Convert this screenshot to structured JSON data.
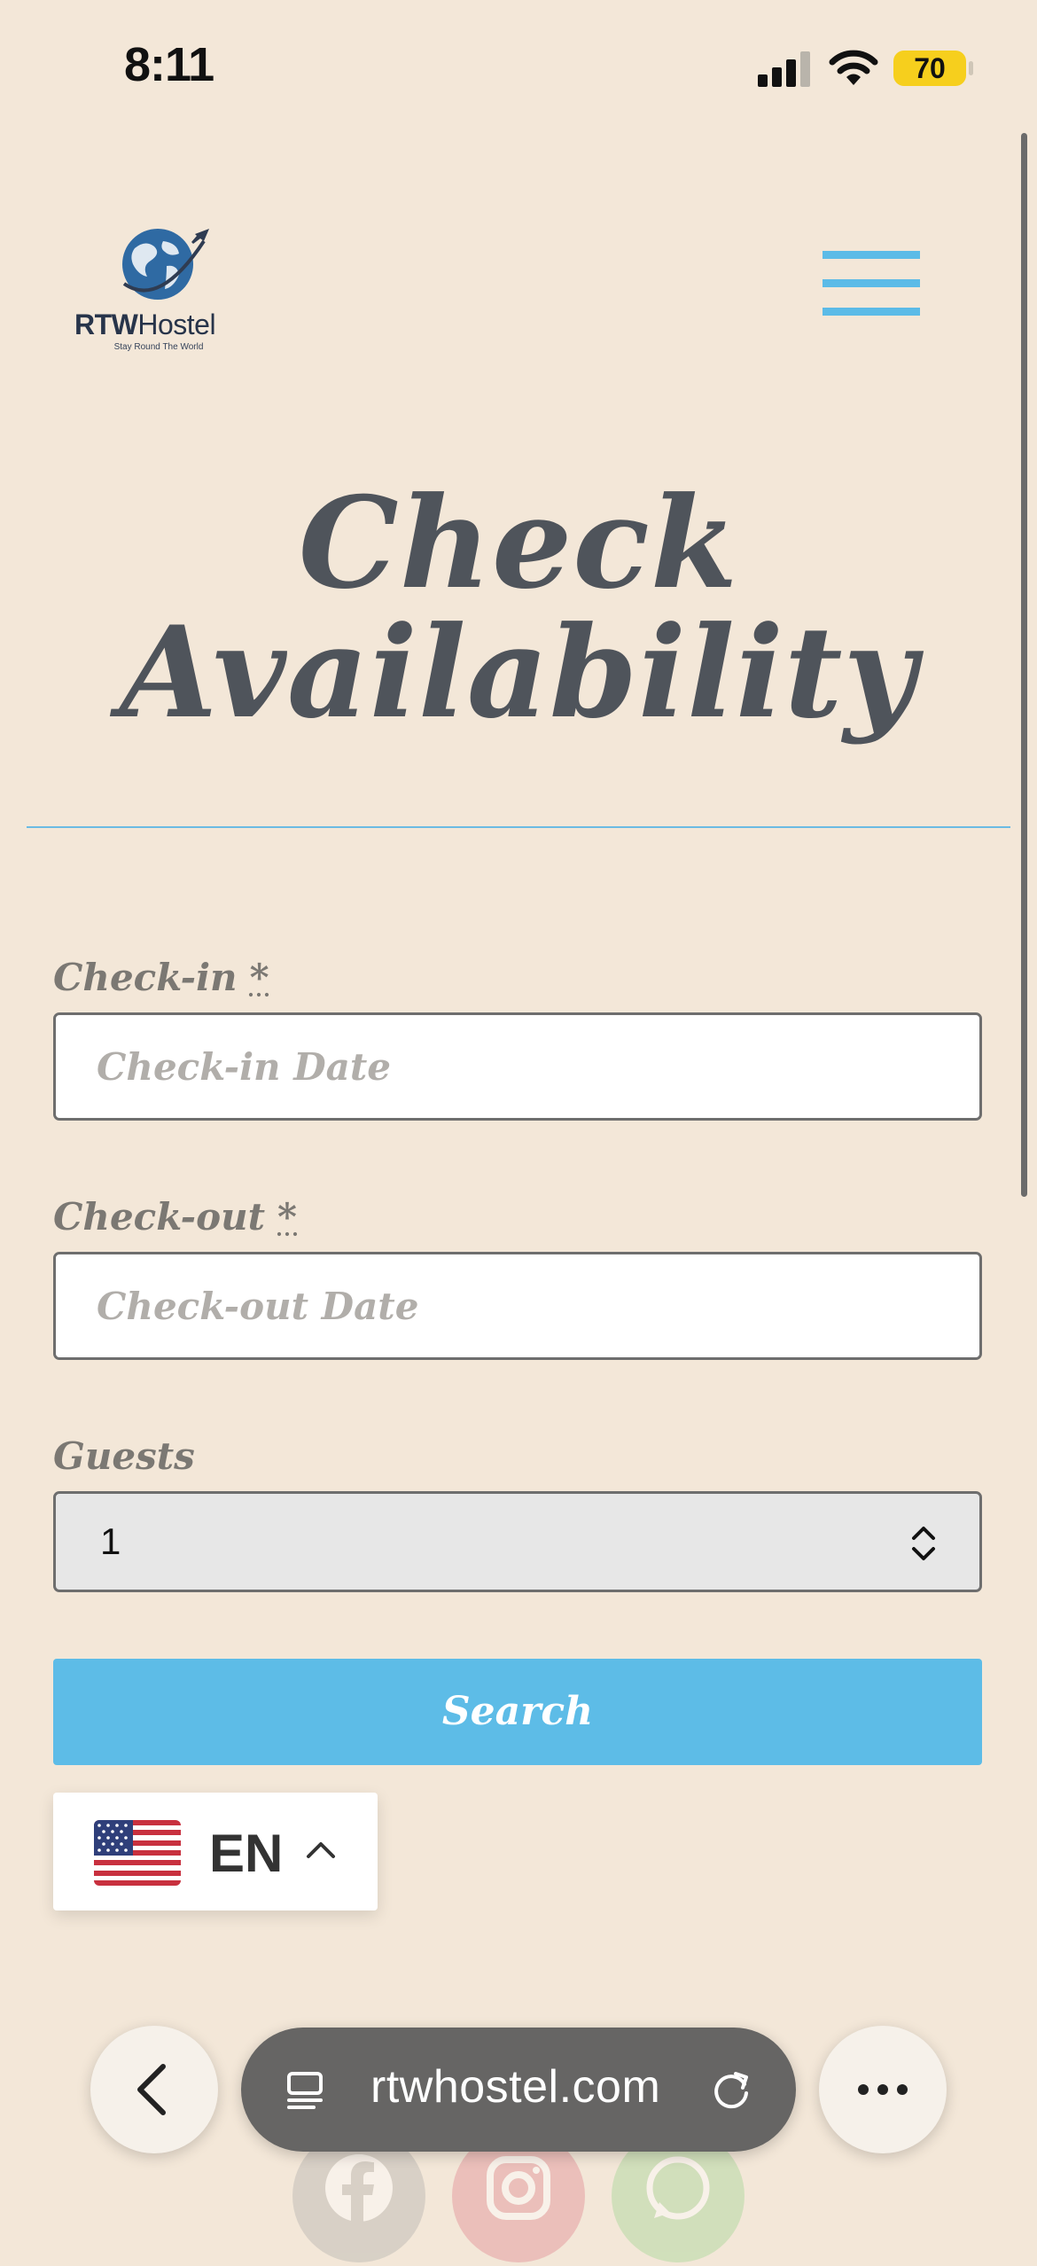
{
  "status_bar": {
    "time": "8:11",
    "battery": "70"
  },
  "header": {
    "logo_brand": "RTW",
    "logo_brand_rest": "Hostel",
    "logo_tagline": "Stay Round The World"
  },
  "page": {
    "title_line1": "Check",
    "title_line2": "Availability"
  },
  "form": {
    "checkin_label": "Check-in",
    "checkin_required": "*",
    "checkin_placeholder": "Check-in Date",
    "checkout_label": "Check-out",
    "checkout_required": "*",
    "checkout_placeholder": "Check-out Date",
    "guests_label": "Guests",
    "guests_value": "1",
    "search_label": "Search"
  },
  "language": {
    "code": "EN",
    "flag": "us-flag"
  },
  "browser": {
    "url": "rtwhostel.com"
  },
  "colors": {
    "background": "#f3e7d8",
    "accent": "#5dbce7",
    "text": "#50555c"
  }
}
